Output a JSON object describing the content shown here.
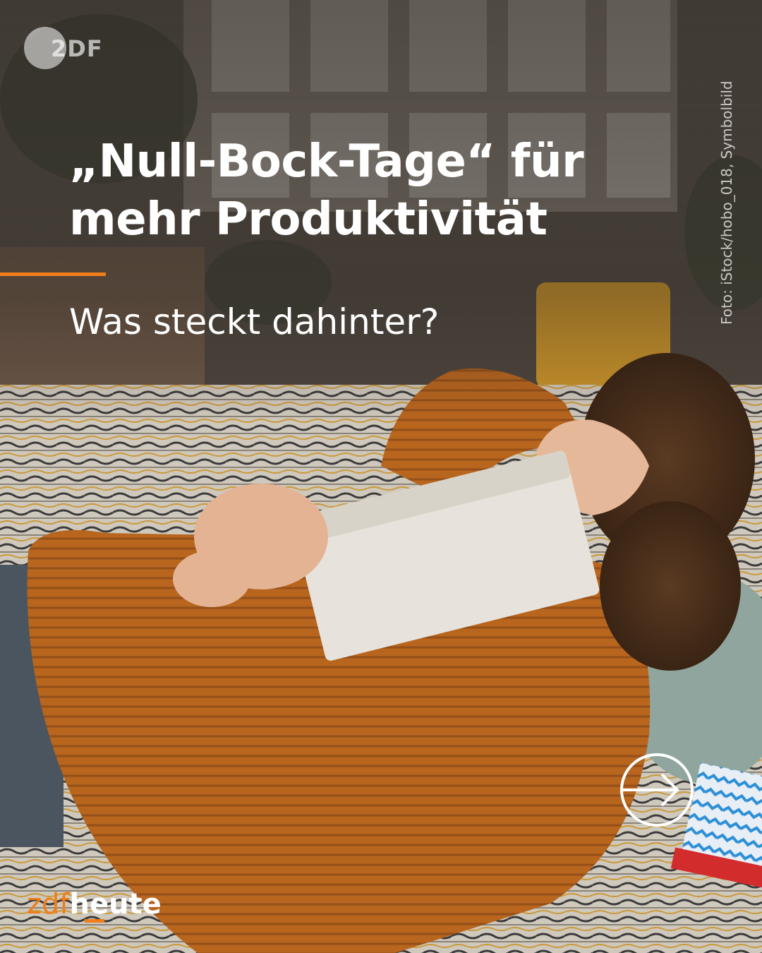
{
  "post": {
    "headline_line1": "„Null-Bock-Tage“ für",
    "headline_line2": "mehr Produktivität",
    "subheadline": "Was steckt dahinter?",
    "photo_credit": "Foto: iStock/hobo_018, Symbolbild"
  },
  "branding": {
    "top_logo": "2DF",
    "footer_part1": "zdf",
    "footer_part2": "heute"
  },
  "icons": {
    "next": "arrow-right-circle-icon",
    "logo": "zdf-logo-icon"
  },
  "colors": {
    "accent": "#f07d1c",
    "text": "#ffffff",
    "sweater": "#b8651e"
  }
}
